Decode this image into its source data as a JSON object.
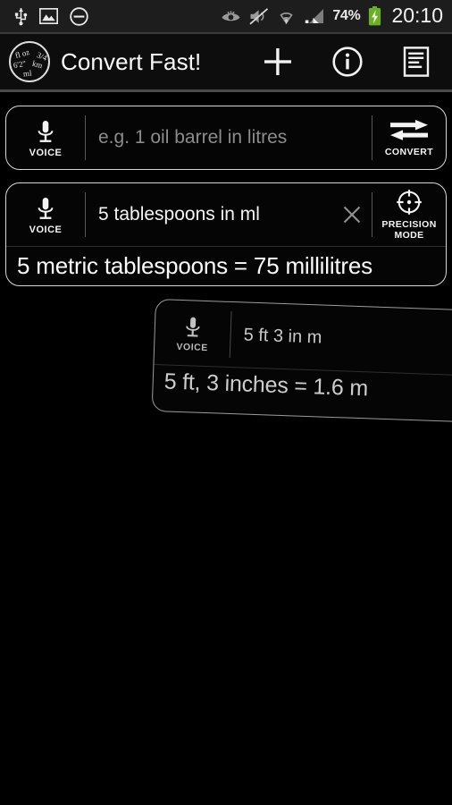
{
  "status_bar": {
    "time": "20:10",
    "battery_percent": "74%",
    "icons": [
      {
        "name": "usb-icon"
      },
      {
        "name": "screenshot-image-icon"
      },
      {
        "name": "do-not-disturb-icon"
      },
      {
        "name": "smart-stay-eye-icon"
      },
      {
        "name": "volume-muted-icon"
      },
      {
        "name": "wifi-icon"
      },
      {
        "name": "cellular-signal-icon"
      },
      {
        "name": "battery-charging-icon"
      }
    ],
    "background_color": "#1d1d1d"
  },
  "app_bar": {
    "title": "Convert Fast!",
    "logo": {
      "name": "convert-fast-logo",
      "texts": [
        "fl oz",
        "3/4",
        "6'2\"",
        "km",
        "ml"
      ]
    },
    "actions": [
      {
        "name": "add-conversion-button",
        "icon": "plus-icon"
      },
      {
        "name": "info-button",
        "icon": "info-icon"
      },
      {
        "name": "history-list-button",
        "icon": "list-document-icon"
      }
    ],
    "background_color": "#0d0d0d"
  },
  "cards": {
    "empty_input": {
      "voice_label": "VOICE",
      "placeholder": "e.g. 1 oil barrel in litres",
      "value": "",
      "action_label": "CONVERT",
      "action_icon": "convert-arrows-icon"
    },
    "active_result": {
      "voice_label": "VOICE",
      "value": "5 tablespoons in ml",
      "clear_icon": "close-x-icon",
      "action_label_line1": "PRECISION",
      "action_label_line2": "MODE",
      "action_icon": "crosshair-target-icon",
      "result": "5 metric tablespoons = 75 millilitres"
    },
    "outgoing_result": {
      "voice_label": "VOICE",
      "value": "5 ft 3 in m",
      "result": "5 ft, 3 inches = 1.6 m"
    }
  },
  "colors": {
    "background": "#000000",
    "card_border": "#d8d8d8",
    "text_primary": "#fafafa",
    "text_placeholder": "#8c8c8c",
    "battery_green": "#6ab023"
  }
}
